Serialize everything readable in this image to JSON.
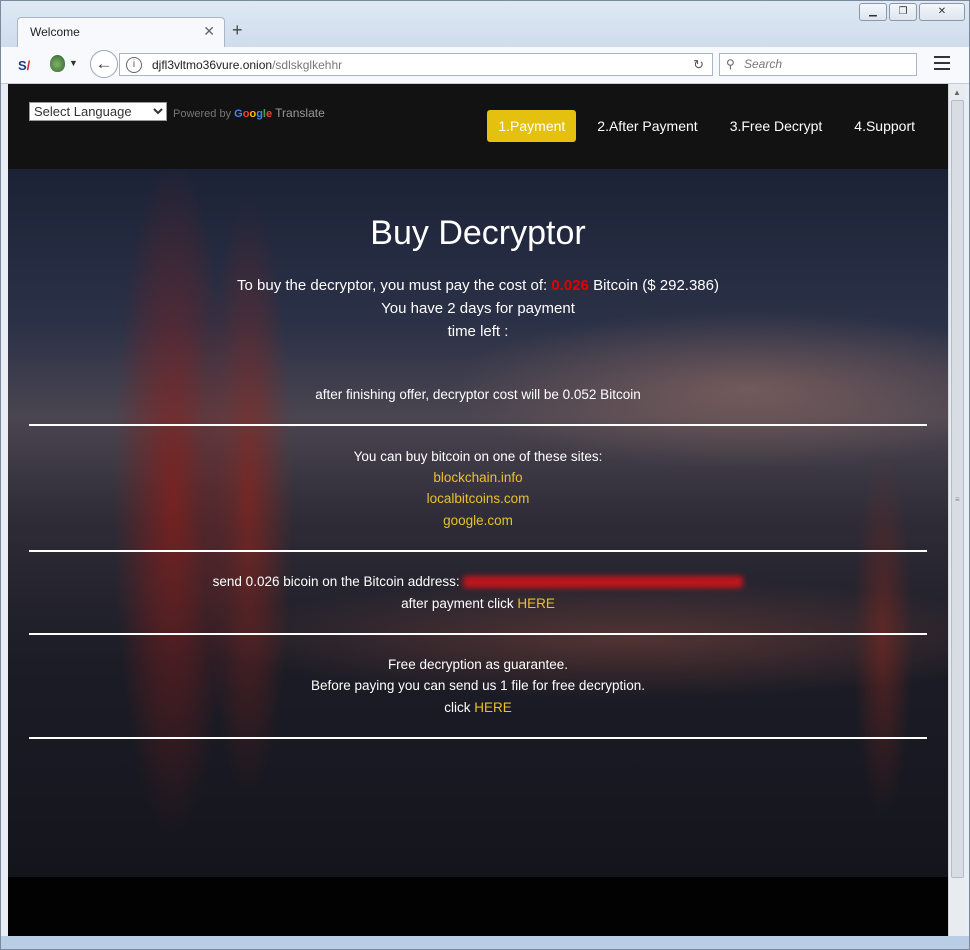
{
  "browser": {
    "tab_title": "Welcome",
    "url_host": "djfl3vltmo36vure.onion",
    "url_path": "/sdlskglkehhr",
    "search_placeholder": "Search"
  },
  "translate": {
    "select_label": "Select Language",
    "powered_by": "Powered by",
    "google": [
      "G",
      "o",
      "o",
      "g",
      "l",
      "e"
    ],
    "translate_word": "Translate"
  },
  "nav": {
    "items": [
      {
        "label": "1.Payment",
        "active": true
      },
      {
        "label": "2.After Payment",
        "active": false
      },
      {
        "label": "3.Free Decrypt",
        "active": false
      },
      {
        "label": "4.Support",
        "active": false
      }
    ]
  },
  "main": {
    "title": "Buy Decryptor",
    "cost_prefix": "To buy the decryptor, you must pay the cost of:",
    "cost_btc": "0.026",
    "cost_suffix": "Bitcoin ($ 292.386)",
    "days_text": "You have 2 days for payment",
    "time_left": "time left :",
    "after_offer": "after finishing offer, decryptor cost will be 0.052 Bitcoin",
    "buy_sites_intro": "You can buy bitcoin on one of these sites:",
    "sites": [
      "blockchain.info",
      "localbitcoins.com",
      "google.com"
    ],
    "send_text": "send 0.026 bicoin on the Bitcoin address:",
    "after_payment_prefix": "after payment click",
    "here_label": "HERE",
    "free_line1": "Free decryption as guarantee.",
    "free_line2": "Before paying you can send us 1 file for free decryption.",
    "click_prefix": "click",
    "here_label_2": "HERE"
  },
  "colors": {
    "accent_yellow": "#e3c10e",
    "link_yellow": "#e9c02a",
    "price_red": "#e10000"
  }
}
